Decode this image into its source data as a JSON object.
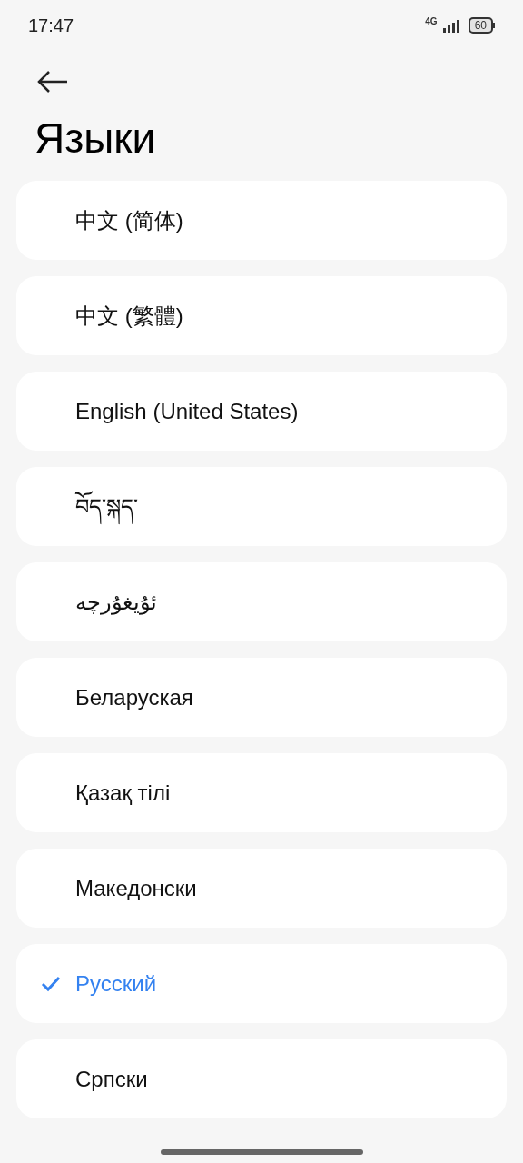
{
  "status_bar": {
    "time": "17:47",
    "network": "4G",
    "battery": "60"
  },
  "header": {
    "title": "Языки"
  },
  "languages": [
    {
      "label": "中文 (简体)",
      "selected": false
    },
    {
      "label": "中文 (繁體)",
      "selected": false
    },
    {
      "label": "English (United States)",
      "selected": false
    },
    {
      "label": "བོད་སྐད་",
      "selected": false
    },
    {
      "label": "ئۇيغۇرچە",
      "selected": false
    },
    {
      "label": "Беларуская",
      "selected": false
    },
    {
      "label": "Қазақ тілі",
      "selected": false
    },
    {
      "label": "Македонски",
      "selected": false
    },
    {
      "label": "Русский",
      "selected": true
    },
    {
      "label": "Српски",
      "selected": false
    }
  ]
}
